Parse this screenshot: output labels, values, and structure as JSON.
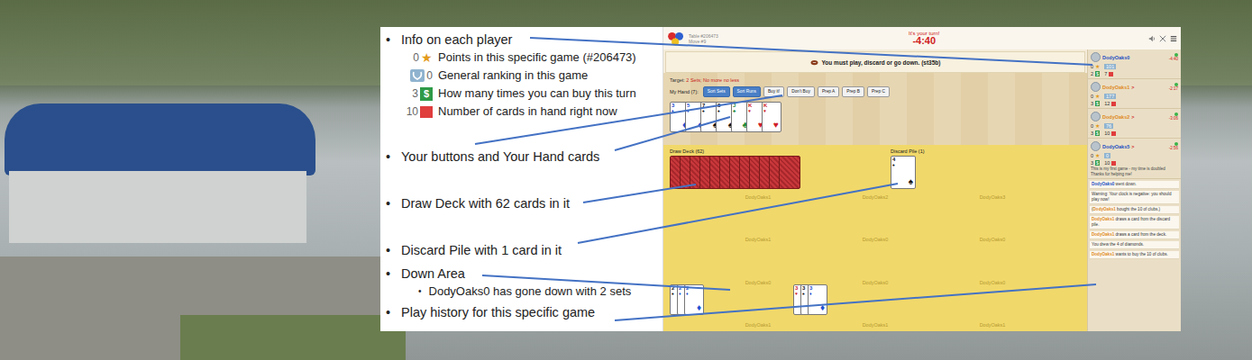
{
  "notes": {
    "bullet": "•",
    "sub_bullet": "•",
    "items": [
      {
        "text": "Info on each player",
        "legend": [
          {
            "value": "0",
            "icon": "★",
            "kind": "star",
            "text": "Points in this specific game (#206473)"
          },
          {
            "value": "0",
            "icon": "",
            "kind": "rank",
            "text": "General ranking in this game"
          },
          {
            "value": "3",
            "icon": "$",
            "kind": "buy",
            "text": "How many times you can buy this turn"
          },
          {
            "value": "10",
            "icon": "",
            "kind": "cards",
            "text": "Number of cards in hand right now"
          }
        ],
        "sub": []
      },
      {
        "text": "Your buttons and Your Hand cards",
        "legend": [],
        "sub": []
      },
      {
        "text": "Draw Deck with 62 cards in it",
        "legend": [],
        "sub": []
      },
      {
        "text": "Discard Pile with 1 card in it",
        "legend": [],
        "sub": []
      },
      {
        "text": "Down Area",
        "legend": [],
        "sub": [
          "DodyOaks0 has gone down with 2 sets"
        ]
      },
      {
        "text": "Play history for this specific game",
        "legend": [],
        "sub": []
      }
    ]
  },
  "game": {
    "table": "Table #206473",
    "move": "Move #9",
    "turn": "It's your turn!",
    "clock": "-4:40",
    "message": "You must play, discard or go down. (st35b)",
    "target_label": "Target:",
    "target": "2 Sets; No more no less",
    "hand_label": "My Hand (7):",
    "buttons": [
      {
        "label": "Sort Sets",
        "kind": "primary"
      },
      {
        "label": "Sort Runs",
        "kind": "primary"
      },
      {
        "label": "Buy it!",
        "kind": "plain"
      },
      {
        "label": "Don't Buy",
        "kind": "plain"
      },
      {
        "label": "Prep A",
        "kind": "plain"
      },
      {
        "label": "Prep B",
        "kind": "plain"
      },
      {
        "label": "Prep C",
        "kind": "plain"
      }
    ],
    "hand": [
      {
        "rank": "3",
        "suit": "♦",
        "color": "#1f4fd1"
      },
      {
        "rank": "5",
        "suit": "♦",
        "color": "#1f4fd1"
      },
      {
        "rank": "7",
        "suit": "♠",
        "color": "#111111"
      },
      {
        "rank": "8",
        "suit": "♠",
        "color": "#111111"
      },
      {
        "rank": "J",
        "suit": "♣",
        "color": "#1d8a3a"
      },
      {
        "rank": "K",
        "suit": "♥",
        "color": "#d0202a"
      },
      {
        "rank": "K",
        "suit": "♥",
        "color": "#d0202a"
      }
    ],
    "draw_deck": {
      "label": "Draw Deck (62)"
    },
    "discard": {
      "label": "Discard Pile (1)",
      "card": {
        "rank": "4",
        "suit": "♠",
        "color": "#111111"
      }
    },
    "seat_labels": [
      "DodyOaks1",
      "DodyOaks2",
      "DodyOaks3",
      "DodyOaks1",
      "DodyOaks0",
      "DodyOaks0",
      "DodyOaks0",
      "DodyOaks0",
      "DodyOaks0",
      "DodyOaks1",
      "DodyOaks1",
      "DodyOaks1"
    ],
    "melds": [
      {
        "cards": [
          {
            "rank": "2",
            "suit": "♠",
            "color": "#111111"
          },
          {
            "rank": "2",
            "suit": "♦",
            "color": "#1f4fd1"
          },
          {
            "rank": "2",
            "suit": "♦",
            "color": "#1f4fd1"
          }
        ]
      },
      {
        "cards": [
          {
            "rank": "3",
            "suit": "♥",
            "color": "#d0202a"
          },
          {
            "rank": "3",
            "suit": "♠",
            "color": "#111111"
          },
          {
            "rank": "3",
            "suit": "♦",
            "color": "#1f4fd1"
          }
        ]
      }
    ],
    "stat_icons": {
      "star": "★",
      "buy": "$"
    },
    "players": [
      {
        "name": "DodyOaks0",
        "arrow": "",
        "color": "#1e4fc2",
        "clock": "-4:40",
        "points": "0",
        "rank": "101",
        "buys": "2",
        "cards": "7",
        "note": ""
      },
      {
        "name": "DodyOaks1",
        "arrow": ">",
        "color": "#e08a1e",
        "clock": "-2:17",
        "points": "0",
        "rank": "177",
        "buys": "3",
        "cards": "12",
        "note": ""
      },
      {
        "name": "DodyOaks2",
        "arrow": ">",
        "color": "#e08a1e",
        "clock": "-3:06",
        "points": "0",
        "rank": "76",
        "buys": "3",
        "cards": "10",
        "note": ""
      },
      {
        "name": "DodyOaks5",
        "arrow": ">",
        "color": "#1e4fc2",
        "clock": "-2:56",
        "points": "0",
        "rank": "0",
        "buys": "3",
        "cards": "10",
        "note": "This is my first game - my time is doubled Thanks for helping me!"
      }
    ],
    "history": [
      {
        "before": "",
        "name": "DodyOaks0",
        "color": "#1e4fc2",
        "text": " went down."
      },
      {
        "before": "",
        "name": "",
        "color": "#1e4fc2",
        "text": "Warning: Your clock is negative: you should play now!"
      },
      {
        "before": "(",
        "name": "DodyOaks1",
        "color": "#e08a1e",
        "text": " bought the 10 of clubs.)"
      },
      {
        "before": "",
        "name": "DodyOaks1",
        "color": "#e08a1e",
        "text": " draws a card from the discard pile."
      },
      {
        "before": "",
        "name": "DodyOaks1",
        "color": "#e08a1e",
        "text": " draws a card from the deck."
      },
      {
        "before": "",
        "name": "",
        "color": "#1e4fc2",
        "text": "You drew the 4 of diamonds."
      },
      {
        "before": "",
        "name": "DodyOaks1",
        "color": "#e08a1e",
        "text": " wants to buy the 10 of clubs."
      }
    ]
  }
}
